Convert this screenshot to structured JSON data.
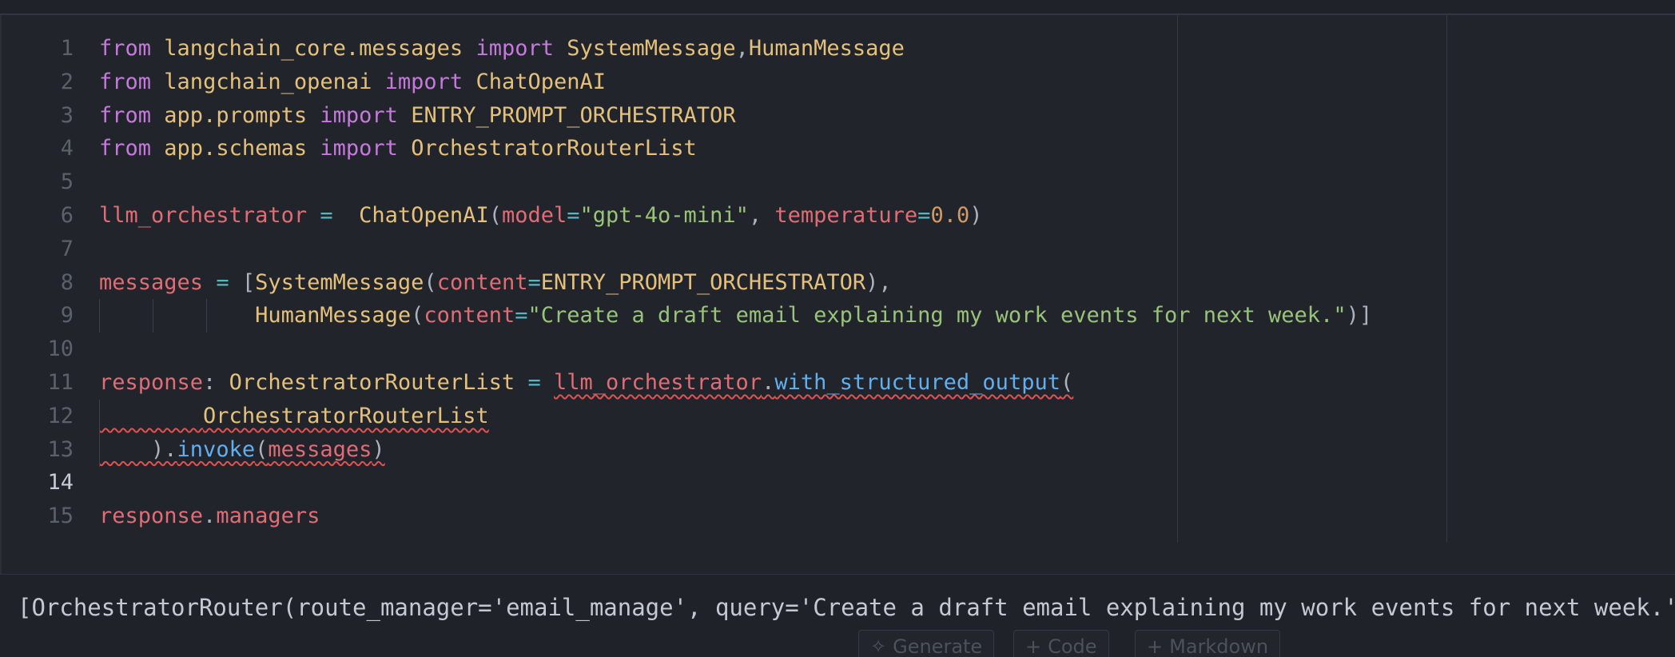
{
  "editor": {
    "lines": [
      {
        "n": "1",
        "tokens": [
          [
            "kw",
            "from"
          ],
          [
            "pun",
            " "
          ],
          [
            "mod",
            "langchain_core.messages"
          ],
          [
            "pun",
            " "
          ],
          [
            "kw",
            "import"
          ],
          [
            "pun",
            " "
          ],
          [
            "cls",
            "SystemMessage"
          ],
          [
            "pun",
            ","
          ],
          [
            "cls",
            "HumanMessage"
          ]
        ]
      },
      {
        "n": "2",
        "tokens": [
          [
            "kw",
            "from"
          ],
          [
            "pun",
            " "
          ],
          [
            "mod",
            "langchain_openai"
          ],
          [
            "pun",
            " "
          ],
          [
            "kw",
            "import"
          ],
          [
            "pun",
            " "
          ],
          [
            "cls",
            "ChatOpenAI"
          ]
        ]
      },
      {
        "n": "3",
        "tokens": [
          [
            "kw",
            "from"
          ],
          [
            "pun",
            " "
          ],
          [
            "mod",
            "app.prompts"
          ],
          [
            "pun",
            " "
          ],
          [
            "kw",
            "import"
          ],
          [
            "pun",
            " "
          ],
          [
            "cls",
            "ENTRY_PROMPT_ORCHESTRATOR"
          ]
        ]
      },
      {
        "n": "4",
        "tokens": [
          [
            "kw",
            "from"
          ],
          [
            "pun",
            " "
          ],
          [
            "mod",
            "app.schemas"
          ],
          [
            "pun",
            " "
          ],
          [
            "kw",
            "import"
          ],
          [
            "pun",
            " "
          ],
          [
            "cls",
            "OrchestratorRouterList"
          ]
        ]
      },
      {
        "n": "5",
        "tokens": []
      },
      {
        "n": "6",
        "tokens": [
          [
            "var",
            "llm_orchestrator"
          ],
          [
            "pun",
            " "
          ],
          [
            "op",
            "="
          ],
          [
            "pun",
            "  "
          ],
          [
            "cls",
            "ChatOpenAI"
          ],
          [
            "pun",
            "("
          ],
          [
            "var",
            "model"
          ],
          [
            "op",
            "="
          ],
          [
            "str",
            "\"gpt-4o-mini\""
          ],
          [
            "pun",
            ", "
          ],
          [
            "var",
            "temperature"
          ],
          [
            "op",
            "="
          ],
          [
            "num",
            "0.0"
          ],
          [
            "pun",
            ")"
          ]
        ]
      },
      {
        "n": "7",
        "tokens": []
      },
      {
        "n": "8",
        "tokens": [
          [
            "var",
            "messages"
          ],
          [
            "pun",
            " "
          ],
          [
            "op",
            "="
          ],
          [
            "pun",
            " ["
          ],
          [
            "cls",
            "SystemMessage"
          ],
          [
            "pun",
            "("
          ],
          [
            "var",
            "content"
          ],
          [
            "op",
            "="
          ],
          [
            "cls",
            "ENTRY_PROMPT_ORCHESTRATOR"
          ],
          [
            "pun",
            "),"
          ]
        ]
      },
      {
        "n": "9",
        "tokens": [
          [
            "pun",
            "            "
          ],
          [
            "cls",
            "HumanMessage"
          ],
          [
            "pun",
            "("
          ],
          [
            "var",
            "content"
          ],
          [
            "op",
            "="
          ],
          [
            "str",
            "\"Create a draft email explaining my work events for next week.\""
          ],
          [
            "pun",
            ")]"
          ]
        ]
      },
      {
        "n": "10",
        "tokens": []
      },
      {
        "n": "11",
        "tokens": [
          [
            "var",
            "response"
          ],
          [
            "pun",
            ": "
          ],
          [
            "cls",
            "OrchestratorRouterList"
          ],
          [
            "pun",
            " "
          ],
          [
            "op",
            "="
          ],
          [
            "pun",
            " "
          ],
          [
            "var squig",
            "llm_orchestrator"
          ],
          [
            "pun squig",
            "."
          ],
          [
            "fn squig",
            "with_structured_output"
          ],
          [
            "pun squig",
            "("
          ]
        ]
      },
      {
        "n": "12",
        "tokens": [
          [
            "pun squig",
            "        "
          ],
          [
            "cls squig",
            "OrchestratorRouterList"
          ]
        ]
      },
      {
        "n": "13",
        "tokens": [
          [
            "pun squig",
            "    )."
          ],
          [
            "fn squig",
            "invoke"
          ],
          [
            "pun squig",
            "("
          ],
          [
            "var squig",
            "messages"
          ],
          [
            "pun squig",
            ")"
          ]
        ]
      },
      {
        "n": "14",
        "tokens": []
      },
      {
        "n": "15",
        "tokens": [
          [
            "var",
            "response"
          ],
          [
            "pun",
            "."
          ],
          [
            "var",
            "managers"
          ]
        ]
      }
    ],
    "active_line": "14"
  },
  "output": {
    "text": "[OrchestratorRouter(route_manager='email_manage', query='Create a draft email explaining my work events for next week.')]"
  },
  "toolbar": {
    "generate_label": "Generate",
    "code_label": "Code",
    "markdown_label": "Markdown"
  },
  "icons": {
    "generate": "sparkle-icon",
    "code": "plus-icon",
    "markdown": "plus-icon"
  }
}
